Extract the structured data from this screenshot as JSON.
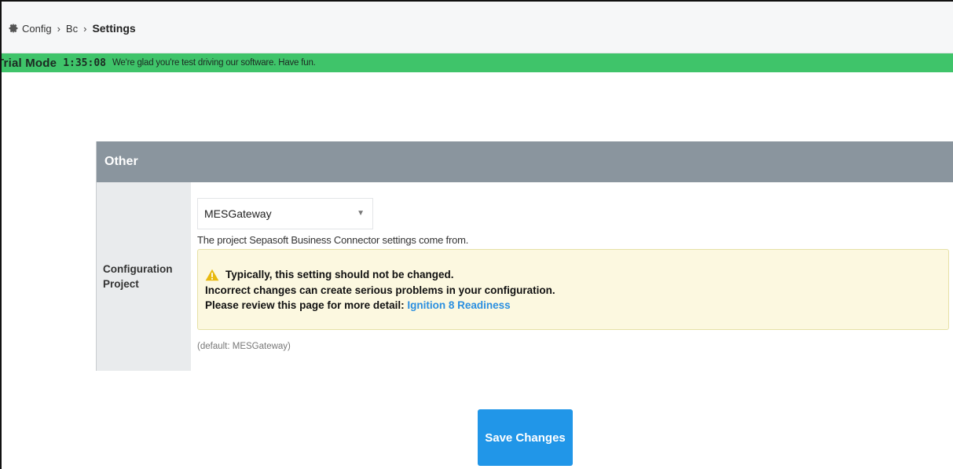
{
  "breadcrumb": {
    "icon": "gear-icon",
    "items": [
      "Config",
      "Bc"
    ],
    "current": "Settings"
  },
  "trial": {
    "label": "Trial Mode",
    "timer": "1:35:08",
    "message": "We're glad you're test driving our software. Have fun.",
    "color": "#3fc46a"
  },
  "section": {
    "title": "Other",
    "header_color": "#8a959e"
  },
  "field": {
    "label_line1": "Configuration",
    "label_line2": "Project",
    "select_value": "MESGateway",
    "description": "The project Sepasoft Business Connector settings come from.",
    "warning": {
      "icon": "warning-icon",
      "line1": "Typically, this setting should not be changed.",
      "line2": "Incorrect changes can create serious problems in your configuration.",
      "line3": "Please review this page for more detail:",
      "link": "Ignition 8 Readiness"
    },
    "default": "(default: MESGateway)"
  },
  "actions": {
    "save_label": "Save Changes",
    "save_color": "#2196e8"
  }
}
